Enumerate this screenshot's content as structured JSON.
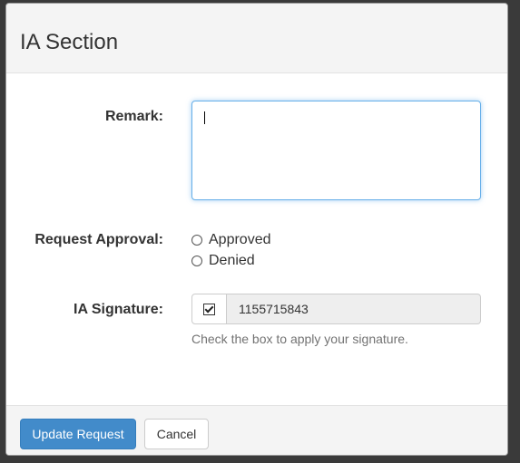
{
  "modal": {
    "title": "IA Section"
  },
  "form": {
    "remark": {
      "label": "Remark:",
      "value": ""
    },
    "request_approval": {
      "label": "Request Approval:",
      "options": [
        "Approved",
        "Denied"
      ],
      "selected": null
    },
    "ia_signature": {
      "label": "IA Signature:",
      "checked": true,
      "value": "1155715843",
      "help": "Check the box to apply your signature."
    }
  },
  "footer": {
    "update_label": "Update Request",
    "cancel_label": "Cancel"
  },
  "colors": {
    "primary": "#428bca",
    "focus_border": "#66afe9",
    "readonly_bg": "#eeeeee"
  }
}
